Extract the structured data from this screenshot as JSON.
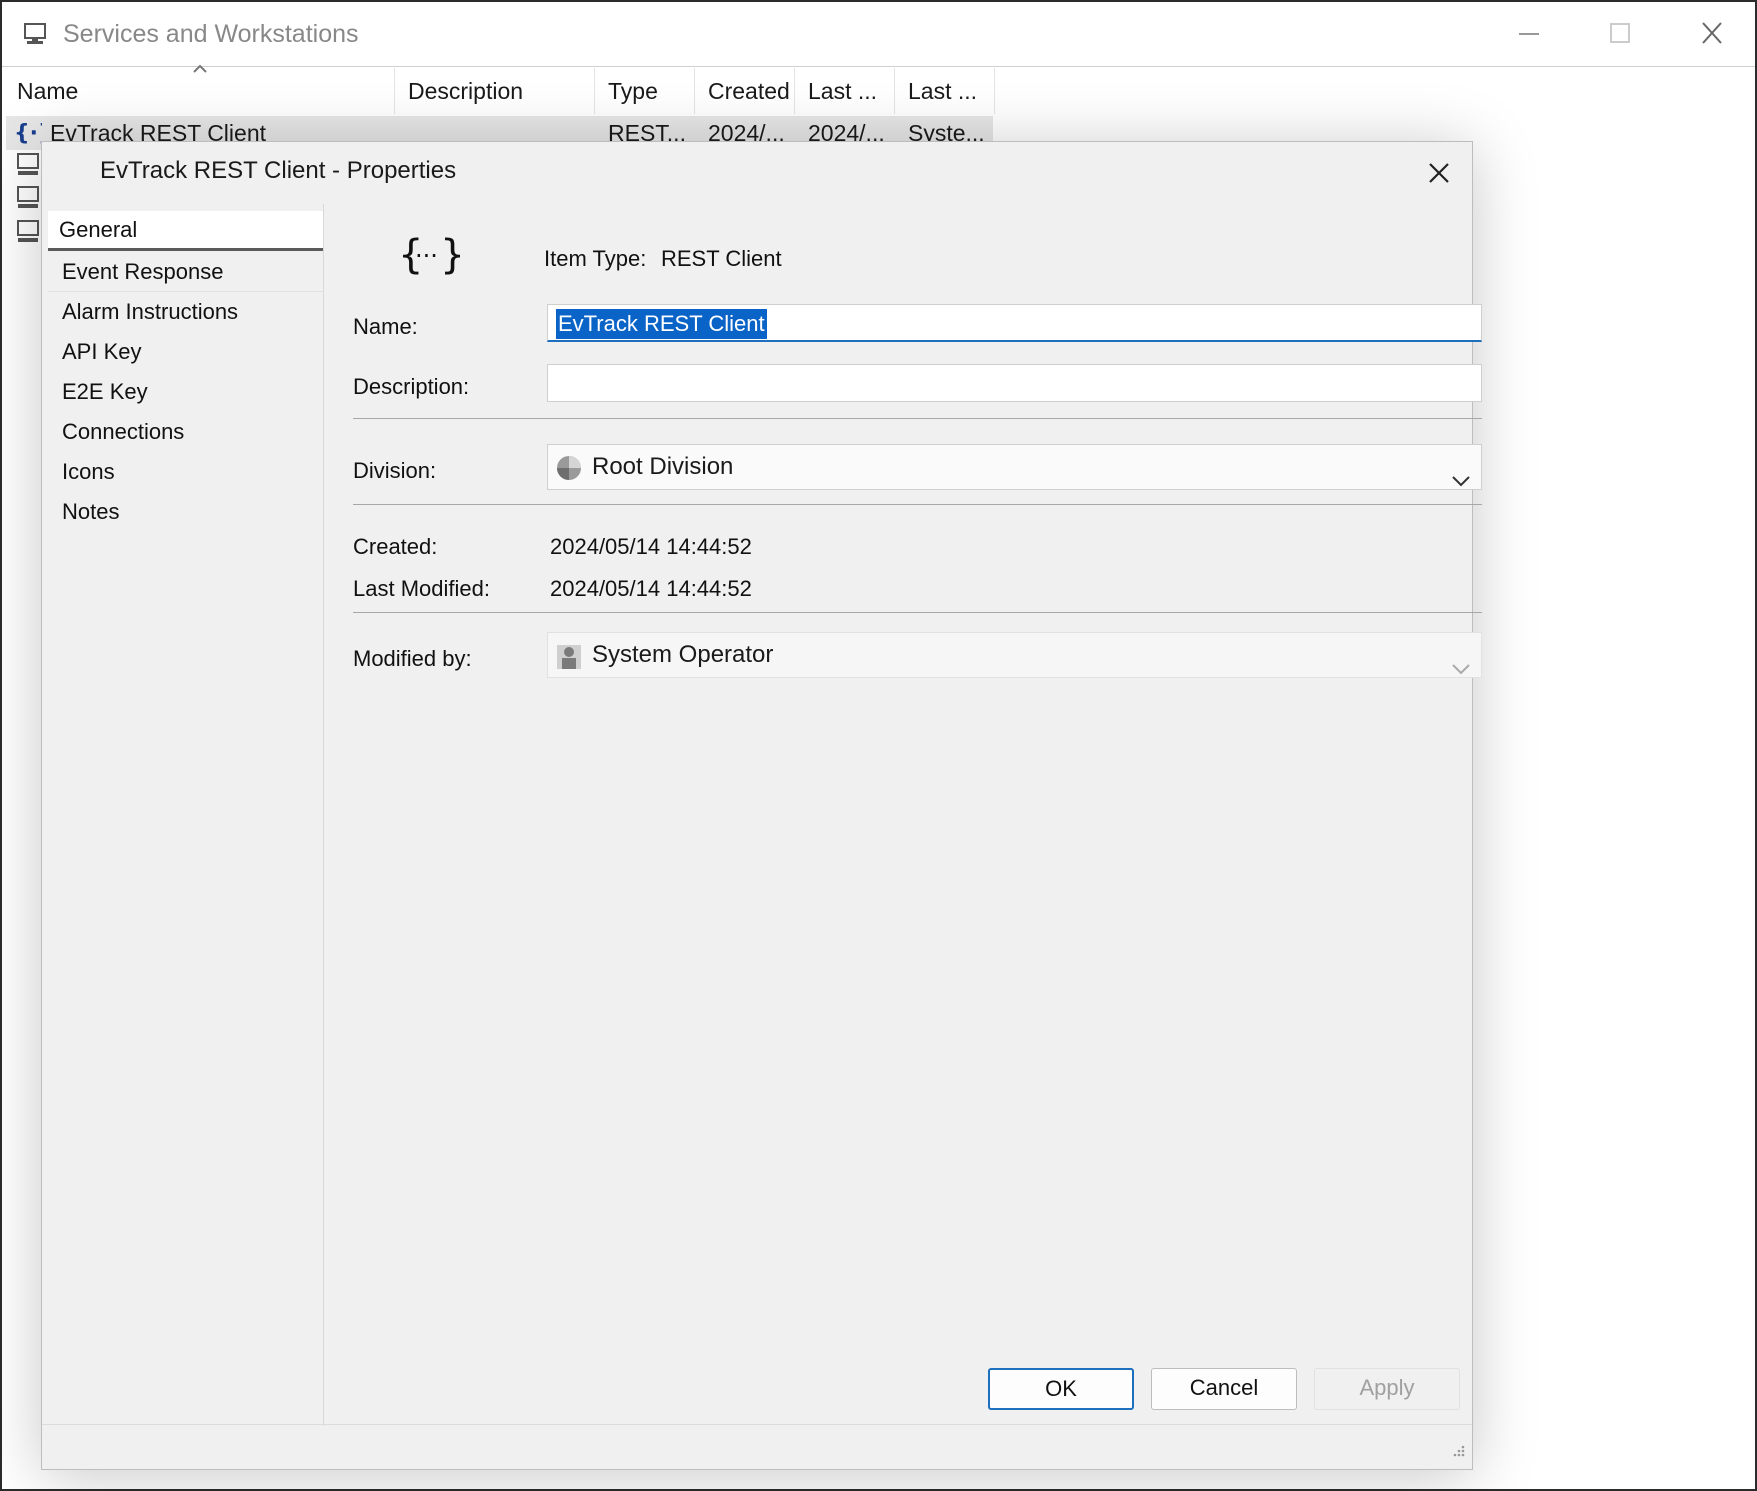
{
  "window": {
    "title": "Services and Workstations",
    "icon": "computer-icon"
  },
  "list": {
    "columns": [
      "Name",
      "Description",
      "Type",
      "Created",
      "Last ...",
      "Last ..."
    ],
    "sorted_column": "Name",
    "rows": [
      {
        "name": "EvTrack REST Client",
        "description": "",
        "type": "REST...",
        "created": "2024/...",
        "last1": "2024/...",
        "last2": "Syste...",
        "icon": "rest-client-icon"
      }
    ],
    "other_row_icons": [
      "workstation-icon",
      "workstation-icon",
      "workstation-icon"
    ]
  },
  "dialog": {
    "title": "EvTrack REST Client - Properties",
    "nav": [
      "General",
      "Event Response",
      "Alarm Instructions",
      "API Key",
      "E2E Key",
      "Connections",
      "Icons",
      "Notes"
    ],
    "selected_nav": "General",
    "item_type_label": "Item Type:",
    "item_type_value": "REST Client",
    "name_label": "Name:",
    "name_value": "EvTrack REST Client",
    "description_label": "Description:",
    "description_value": "",
    "division_label": "Division:",
    "division_value": "Root Division",
    "created_label": "Created:",
    "created_value": "2024/05/14 14:44:52",
    "last_modified_label": "Last Modified:",
    "last_modified_value": "2024/05/14 14:44:52",
    "modified_by_label": "Modified by:",
    "modified_by_value": "System Operator",
    "buttons": {
      "ok": "OK",
      "cancel": "Cancel",
      "apply": "Apply"
    }
  },
  "colors": {
    "accent": "#1f6fbf",
    "selection": "#0a64c8",
    "dialog_bg": "#f0f0f0"
  }
}
